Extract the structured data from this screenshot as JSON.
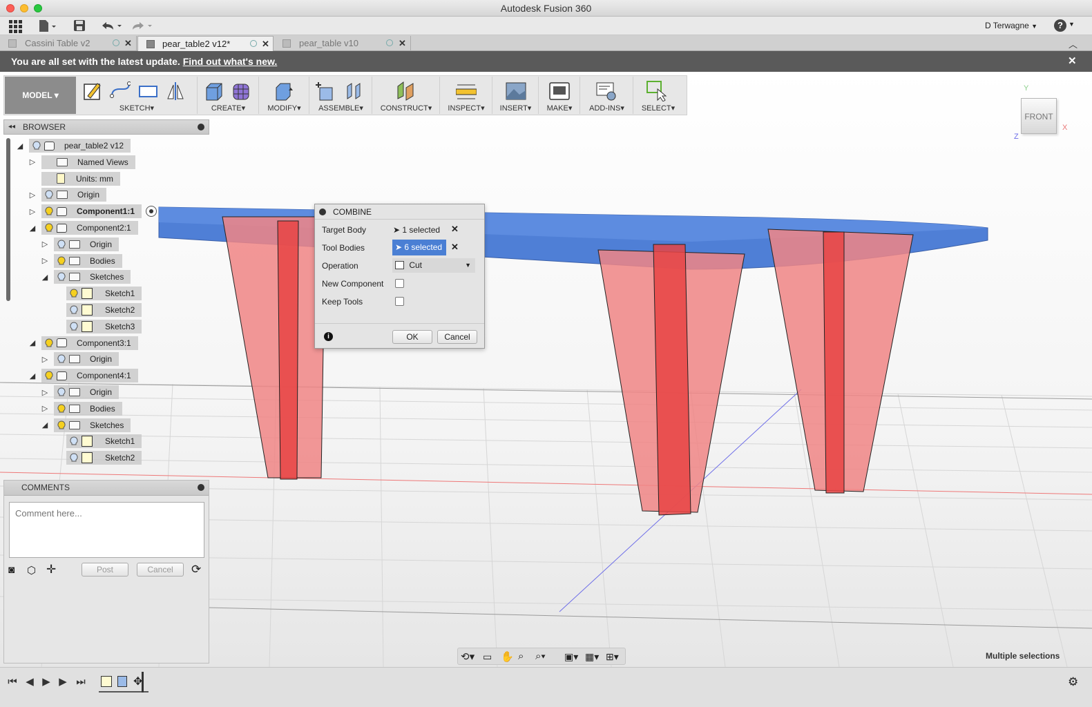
{
  "window": {
    "title": "Autodesk Fusion 360"
  },
  "toolbar": {
    "user": "D Terwagne",
    "user_menu_icon": "caret-down-icon",
    "help": "?"
  },
  "tabs": [
    {
      "label": "Cassini Table v2",
      "active": false
    },
    {
      "label": "pear_table2 v12*",
      "active": true
    },
    {
      "label": "pear_table v10",
      "active": false
    }
  ],
  "banner": {
    "text": "You are all set with the latest update.",
    "link": "Find out what's new."
  },
  "ribbon": {
    "workspace": "MODEL",
    "groups": [
      "SKETCH",
      "CREATE",
      "MODIFY",
      "ASSEMBLE",
      "CONSTRUCT",
      "INSPECT",
      "INSERT",
      "MAKE",
      "ADD-INS",
      "SELECT"
    ]
  },
  "viewcube": {
    "face": "FRONT",
    "x_axis": "X",
    "y_axis": "Y",
    "z_axis": "Z"
  },
  "browser": {
    "title": "BROWSER",
    "items": [
      {
        "label": "pear_table2 v12",
        "icon": "component-icon"
      },
      {
        "label": "Named Views",
        "icon": "folder-icon"
      },
      {
        "label": "Units: mm",
        "icon": "document-icon"
      },
      {
        "label": "Origin",
        "icon": "folder-icon"
      },
      {
        "label": "Component1:1",
        "icon": "component-icon"
      },
      {
        "label": "Component2:1",
        "icon": "component-icon"
      },
      {
        "label": "Origin",
        "icon": "folder-icon"
      },
      {
        "label": "Bodies",
        "icon": "folder-icon"
      },
      {
        "label": "Sketches",
        "icon": "folder-icon"
      },
      {
        "label": "Sketch1",
        "icon": "sketch-icon"
      },
      {
        "label": "Sketch2",
        "icon": "sketch-icon"
      },
      {
        "label": "Sketch3",
        "icon": "sketch-icon"
      },
      {
        "label": "Component3:1",
        "icon": "component-icon"
      },
      {
        "label": "Origin",
        "icon": "folder-icon"
      },
      {
        "label": "Component4:1",
        "icon": "component-icon"
      },
      {
        "label": "Origin",
        "icon": "folder-icon"
      },
      {
        "label": "Bodies",
        "icon": "folder-icon"
      },
      {
        "label": "Sketches",
        "icon": "folder-icon"
      },
      {
        "label": "Sketch1",
        "icon": "sketch-icon"
      },
      {
        "label": "Sketch2",
        "icon": "sketch-icon"
      }
    ]
  },
  "comments": {
    "title": "COMMENTS",
    "placeholder": "Comment here...",
    "post": "Post",
    "cancel": "Cancel"
  },
  "combine": {
    "title": "COMBINE",
    "target_body_label": "Target Body",
    "target_body_value": "1 selected",
    "tool_bodies_label": "Tool Bodies",
    "tool_bodies_value": "6 selected",
    "operation_label": "Operation",
    "operation_value": "Cut",
    "new_component_label": "New Component",
    "new_component_checked": false,
    "keep_tools_label": "Keep Tools",
    "keep_tools_checked": false,
    "ok": "OK",
    "cancel": "Cancel"
  },
  "status": {
    "selection": "Multiple selections"
  },
  "colors": {
    "accent": "#4a7fd4",
    "table_top": "#4f7fd6",
    "legs": "#f08080",
    "banner": "#5a5a5a"
  }
}
